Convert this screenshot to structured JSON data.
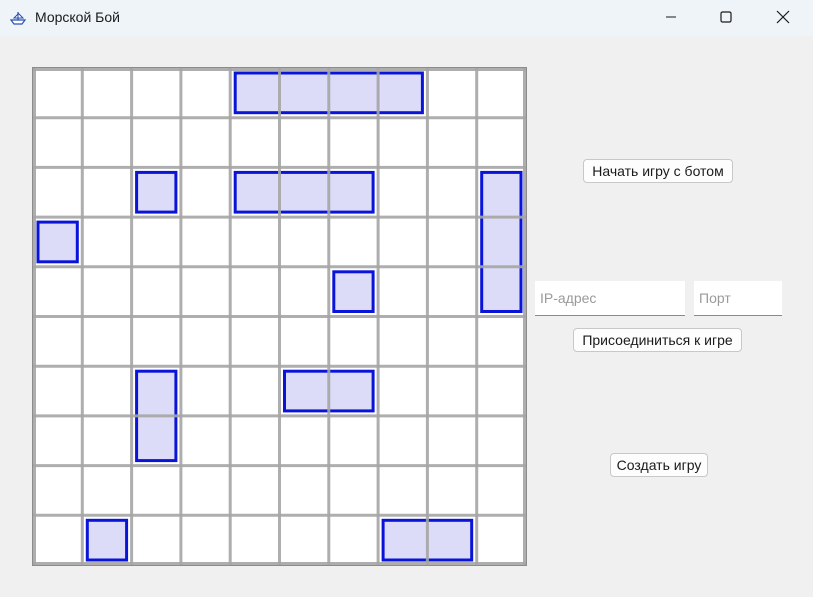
{
  "window": {
    "title": "Морской Бой",
    "app_icon": "ship-icon",
    "controls": [
      "minimize-icon",
      "maximize-icon",
      "close-icon"
    ]
  },
  "board": {
    "rows": 10,
    "cols": 10,
    "grid_color": "#a6a6a6",
    "ship_fill": "#dcdcf8",
    "ship_stroke": "#0a14d8",
    "ships": [
      {
        "row": 0,
        "col": 4,
        "length": 4,
        "orientation": "horizontal"
      },
      {
        "row": 2,
        "col": 2,
        "length": 1,
        "orientation": "horizontal"
      },
      {
        "row": 2,
        "col": 4,
        "length": 3,
        "orientation": "horizontal"
      },
      {
        "row": 2,
        "col": 9,
        "length": 3,
        "orientation": "vertical"
      },
      {
        "row": 3,
        "col": 0,
        "length": 1,
        "orientation": "horizontal"
      },
      {
        "row": 4,
        "col": 6,
        "length": 1,
        "orientation": "horizontal"
      },
      {
        "row": 6,
        "col": 2,
        "length": 2,
        "orientation": "vertical"
      },
      {
        "row": 6,
        "col": 5,
        "length": 2,
        "orientation": "horizontal"
      },
      {
        "row": 9,
        "col": 1,
        "length": 1,
        "orientation": "horizontal"
      },
      {
        "row": 9,
        "col": 7,
        "length": 2,
        "orientation": "horizontal"
      }
    ]
  },
  "controls": {
    "bot_button": "Начать игру с ботом",
    "ip_placeholder": "IP-адрес",
    "ip_value": "",
    "port_placeholder": "Порт",
    "port_value": "",
    "join_button": "Присоединиться к игре",
    "create_button": "Создать игру"
  }
}
